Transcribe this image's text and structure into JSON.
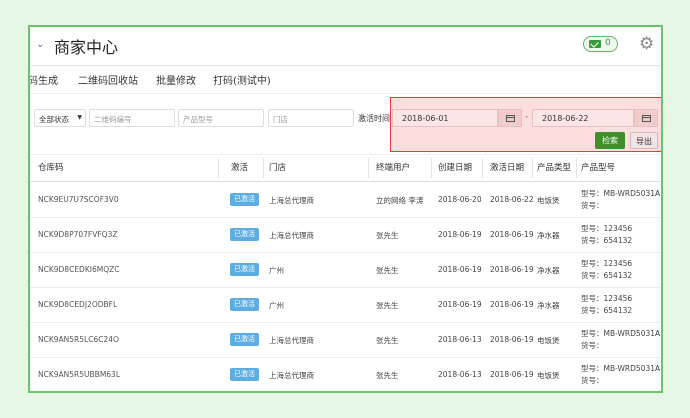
{
  "header": {
    "title": "商家中心",
    "message_count": "0"
  },
  "nav": {
    "items": [
      "码生成",
      "二维码回收站",
      "批量修改",
      "打码(测试中)"
    ]
  },
  "filter": {
    "status_value": "全部状态",
    "qr_code_placeholder": "二维码编号",
    "product_model_placeholder": "产品型号",
    "store_placeholder": "门店",
    "activation_time_label": "激活时间",
    "date_from": "2018-06-01",
    "date_separator": "-",
    "date_to": "2018-06-22",
    "search_label": "检索",
    "export_label": "导出"
  },
  "table": {
    "columns": [
      "仓库码",
      "激活",
      "门店",
      "终端用户",
      "创建日期",
      "激活日期",
      "产品类型",
      "产品型号"
    ],
    "rows": [
      {
        "code": "NCK9EU7U7SCOF3V0",
        "status": "已激活",
        "store": "上海总代理商",
        "user": "立的网络 李涛",
        "created": "2018-06-20",
        "activated": "2018-06-22",
        "type": "电饭煲",
        "model_line1": "型号：MB-WRD5031A",
        "model_line2": "货号："
      },
      {
        "code": "NCK9D8P707FVFQ3Z",
        "status": "已激活",
        "store": "上海总代理商",
        "user": "张先生",
        "created": "2018-06-19",
        "activated": "2018-06-19",
        "type": "净水器",
        "model_line1": "型号：123456",
        "model_line2": "货号：654132"
      },
      {
        "code": "NCK9D8CEDKI6MQZC",
        "status": "已激活",
        "store": "广州",
        "user": "张先生",
        "created": "2018-06-19",
        "activated": "2018-06-19",
        "type": "净水器",
        "model_line1": "型号：123456",
        "model_line2": "货号：654132"
      },
      {
        "code": "NCK9D8CEDJ2ODBFL",
        "status": "已激活",
        "store": "广州",
        "user": "张先生",
        "created": "2018-06-19",
        "activated": "2018-06-19",
        "type": "净水器",
        "model_line1": "型号：123456",
        "model_line2": "货号：654132"
      },
      {
        "code": "NCK9AN5R5LC6C24O",
        "status": "已激活",
        "store": "上海总代理商",
        "user": "张先生",
        "created": "2018-06-13",
        "activated": "2018-06-19",
        "type": "电饭煲",
        "model_line1": "型号：MB-WRD5031A",
        "model_line2": "货号："
      },
      {
        "code": "NCK9AN5R5UBBM63L",
        "status": "已激活",
        "store": "上海总代理商",
        "user": "张先生",
        "created": "2018-06-13",
        "activated": "2018-06-19",
        "type": "电饭煲",
        "model_line1": "型号：MB-WRD5031A",
        "model_line2": "货号："
      }
    ]
  },
  "colors": {
    "highlight_border": "#e23b3b",
    "highlight_fill": "#fcdede",
    "search_button": "#3f8f2a",
    "badge": "#5dade2",
    "frame_border": "#6cc36c"
  }
}
